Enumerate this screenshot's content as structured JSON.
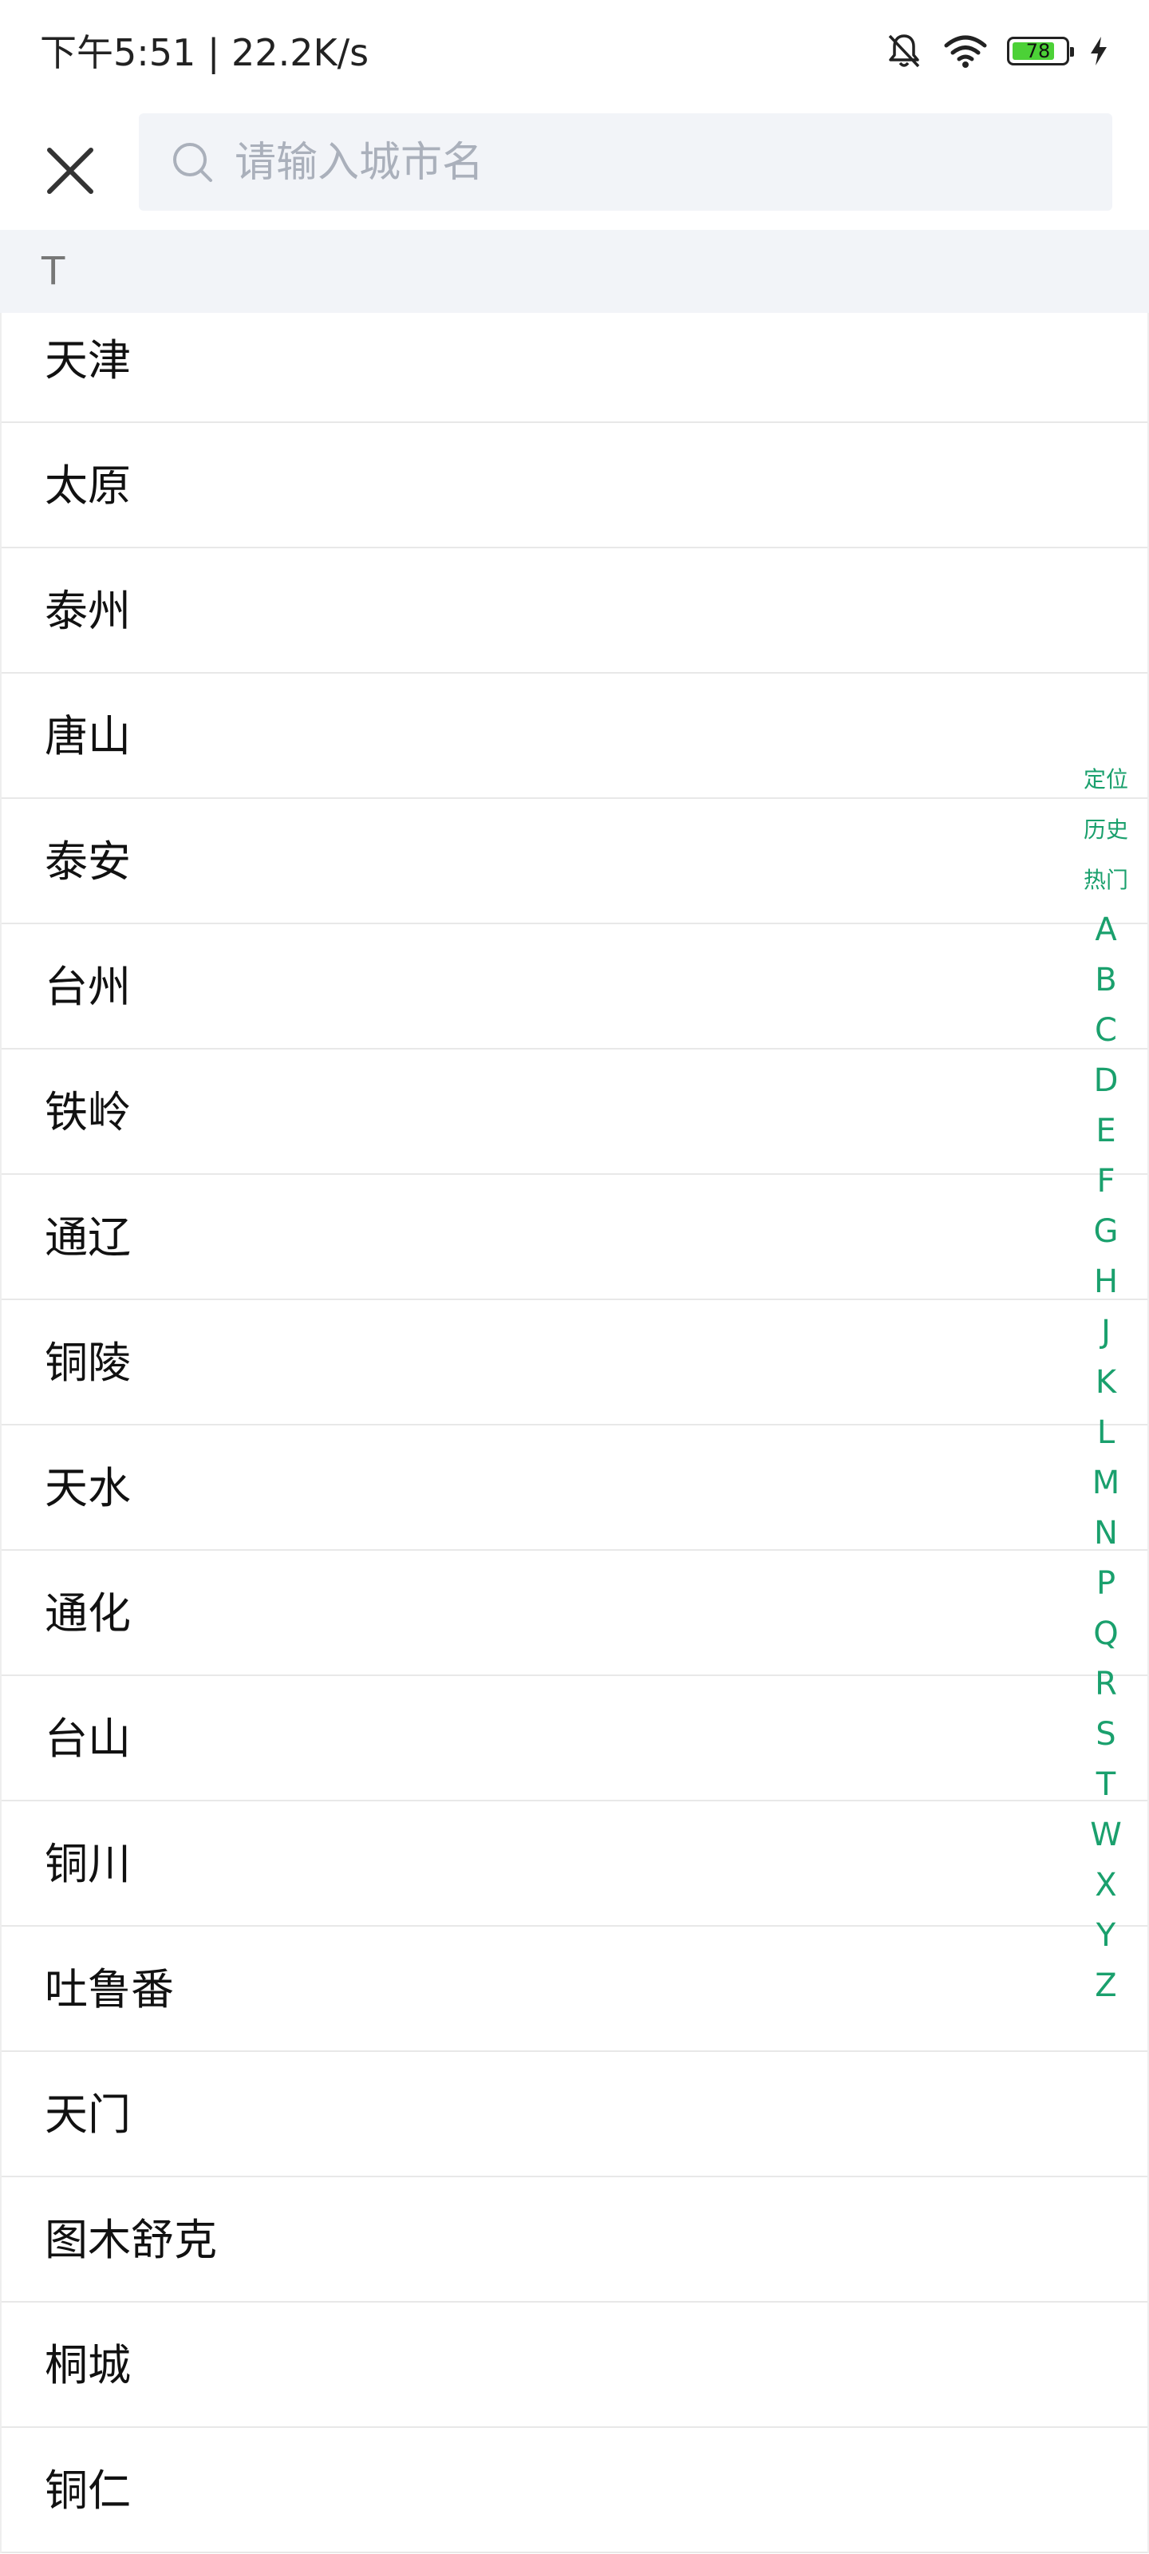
{
  "status_bar": {
    "time_speed": "下午5:51 | 22.2K/s",
    "battery_level": "78",
    "icons": [
      "mute-bell-icon",
      "wifi-icon",
      "battery-icon",
      "charging-icon"
    ]
  },
  "search": {
    "placeholder": "请输入城市名",
    "value": ""
  },
  "section": {
    "letter": "T"
  },
  "cities": [
    "天津",
    "太原",
    "泰州",
    "唐山",
    "泰安",
    "台州",
    "铁岭",
    "通辽",
    "铜陵",
    "天水",
    "通化",
    "台山",
    "铜川",
    "吐鲁番",
    "天门",
    "图木舒克",
    "桐城",
    "铜仁"
  ],
  "index": {
    "words": [
      "定位",
      "历史",
      "热门"
    ],
    "letters": [
      "A",
      "B",
      "C",
      "D",
      "E",
      "F",
      "G",
      "H",
      "J",
      "K",
      "L",
      "M",
      "N",
      "P",
      "Q",
      "R",
      "S",
      "T",
      "W",
      "X",
      "Y",
      "Z"
    ]
  },
  "colors": {
    "accent": "#1aa06d",
    "search_bg": "#f2f4f8",
    "battery": "#4cd137"
  }
}
